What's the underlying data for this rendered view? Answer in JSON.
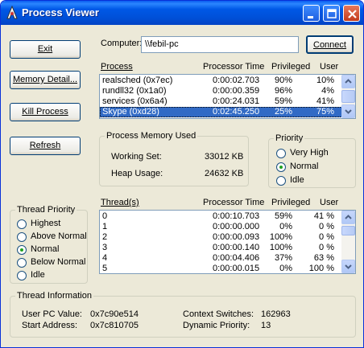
{
  "window": {
    "title": "Process Viewer",
    "colors": {
      "titlebar": "#0058e6",
      "selection": "#316ac5",
      "face": "#ece9d8"
    }
  },
  "buttons": {
    "exit": "Exit",
    "memory_detail": "Memory Detail...",
    "kill_process": "Kill Process",
    "refresh": "Refresh",
    "connect": "Connect"
  },
  "computer": {
    "label": "Computer:",
    "value": "\\\\febil-pc"
  },
  "process_list": {
    "headers": {
      "name": "Process",
      "time": "Processor Time",
      "priv": "Privileged",
      "user": "User"
    },
    "rows": [
      {
        "name": "realsched (0x7ec)",
        "time": "0:00:02.703",
        "priv": "90%",
        "user": "10%"
      },
      {
        "name": "rundll32 (0x1a0)",
        "time": "0:00:00.359",
        "priv": "96%",
        "user": "4%"
      },
      {
        "name": "services (0x6a4)",
        "time": "0:00:24.031",
        "priv": "59%",
        "user": "41%"
      },
      {
        "name": "Skype (0xd28)",
        "time": "0:02:45.250",
        "priv": "25%",
        "user": "75%"
      }
    ],
    "selected_index": 3
  },
  "process_memory": {
    "title": "Process Memory Used",
    "working_set_label": "Working Set:",
    "working_set_value": "33012 KB",
    "heap_usage_label": "Heap Usage:",
    "heap_usage_value": "24632 KB"
  },
  "priority": {
    "title": "Priority",
    "options": [
      "Very High",
      "Normal",
      "Idle"
    ],
    "selected": "Normal"
  },
  "thread_priority": {
    "title": "Thread Priority",
    "options": [
      "Highest",
      "Above Normal",
      "Normal",
      "Below Normal",
      "Idle"
    ],
    "selected": "Normal"
  },
  "thread_list": {
    "headers": {
      "name": "Thread(s)",
      "time": "Processor Time",
      "priv": "Privileged",
      "user": "User"
    },
    "rows": [
      {
        "name": "0",
        "time": "0:00:10.703",
        "priv": "59%",
        "user": "41 %"
      },
      {
        "name": "1",
        "time": "0:00:00.000",
        "priv": "0%",
        "user": "0 %"
      },
      {
        "name": "2",
        "time": "0:00:00.093",
        "priv": "100%",
        "user": "0 %"
      },
      {
        "name": "3",
        "time": "0:00:00.140",
        "priv": "100%",
        "user": "0 %"
      },
      {
        "name": "4",
        "time": "0:00:04.406",
        "priv": "37%",
        "user": "63 %"
      },
      {
        "name": "5",
        "time": "0:00:00.015",
        "priv": "0%",
        "user": "100 %"
      }
    ]
  },
  "thread_info": {
    "title": "Thread Information",
    "user_pc_label": "User PC Value:",
    "user_pc_value": "0x7c90e514",
    "start_address_label": "Start Address:",
    "start_address_value": "0x7c810705",
    "context_switches_label": "Context Switches:",
    "context_switches_value": "162963",
    "dynamic_priority_label": "Dynamic Priority:",
    "dynamic_priority_value": "13"
  }
}
